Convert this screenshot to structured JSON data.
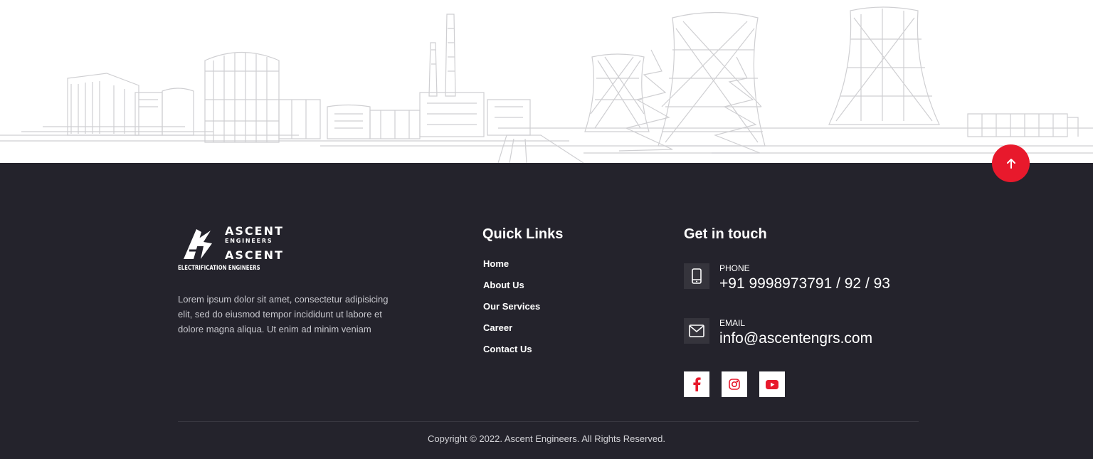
{
  "footer": {
    "logo": {
      "primary_name": "ASCENT",
      "primary_sub": "ENGINEERS",
      "secondary_name": "ASCENT",
      "secondary_sub": "ELECTRIFICATION ENGINEERS"
    },
    "about_text": "Lorem ipsum dolor sit amet, consectetur adipisicing elit, sed do eiusmod tempor incididunt ut labore et dolore magna aliqua. Ut enim ad minim veniam",
    "quick_links": {
      "title": "Quick Links",
      "items": [
        {
          "label": "Home"
        },
        {
          "label": "About Us"
        },
        {
          "label": "Our Services"
        },
        {
          "label": "Career"
        },
        {
          "label": "Contact Us"
        }
      ]
    },
    "contact": {
      "title": "Get in touch",
      "phone": {
        "label": "PHONE",
        "value": "+91 9998973791 / 92 / 93",
        "icon": "phone-icon"
      },
      "email": {
        "label": "EMAIL",
        "value": "info@ascentengrs.com",
        "icon": "mail-icon"
      }
    },
    "social": [
      {
        "name": "facebook",
        "icon": "facebook-icon"
      },
      {
        "name": "instagram",
        "icon": "instagram-icon"
      },
      {
        "name": "youtube",
        "icon": "youtube-icon"
      }
    ],
    "copyright": "Copyright © 2022. Ascent Engineers. All Rights Reserved."
  },
  "colors": {
    "footer_bg": "#24232c",
    "accent": "#e8192c",
    "text_light": "#ffffff",
    "text_muted": "#c9c9cf",
    "icon_box": "#35343c"
  },
  "back_to_top": {
    "icon": "arrow-up-icon"
  }
}
